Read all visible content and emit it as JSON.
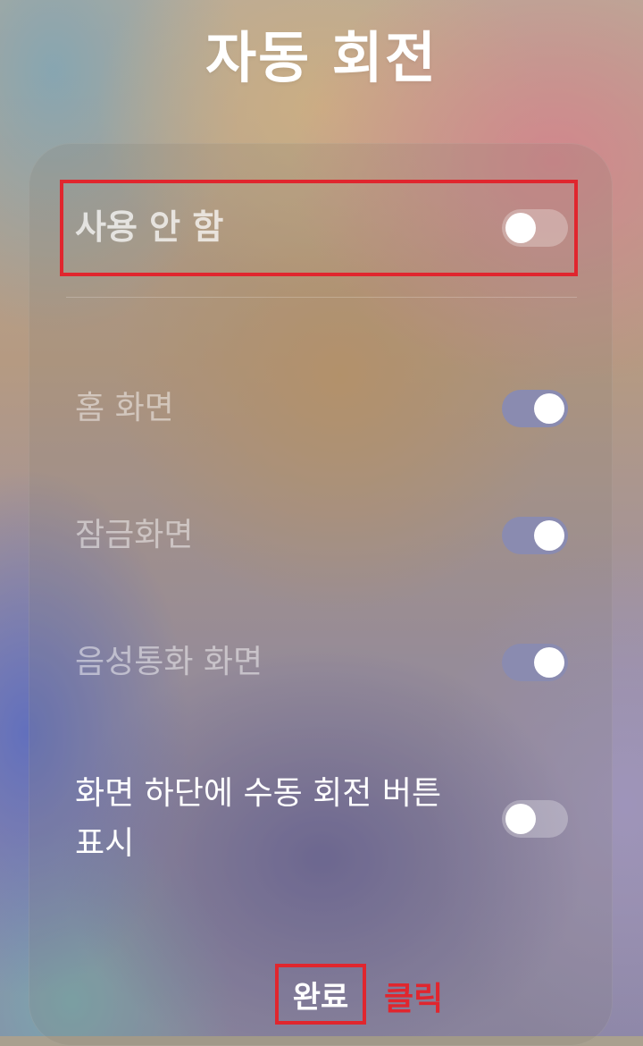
{
  "header": {
    "title": "자동 회전"
  },
  "settings": [
    {
      "label": "사용 안 함",
      "enabled": false
    },
    {
      "label": "홈 화면",
      "enabled": true
    },
    {
      "label": "잠금화면",
      "enabled": true
    },
    {
      "label": "음성통화 화면",
      "enabled": true
    },
    {
      "label": "화면 하단에 수동 회전 버튼\n표시",
      "enabled": false
    }
  ],
  "footer": {
    "done_label": "완료",
    "click_annotation": "클릭"
  },
  "colors": {
    "annotation_red": "#e0262e",
    "toggle_on": "#8a8bb0",
    "toggle_off": "rgba(255,255,255,0.28)"
  }
}
